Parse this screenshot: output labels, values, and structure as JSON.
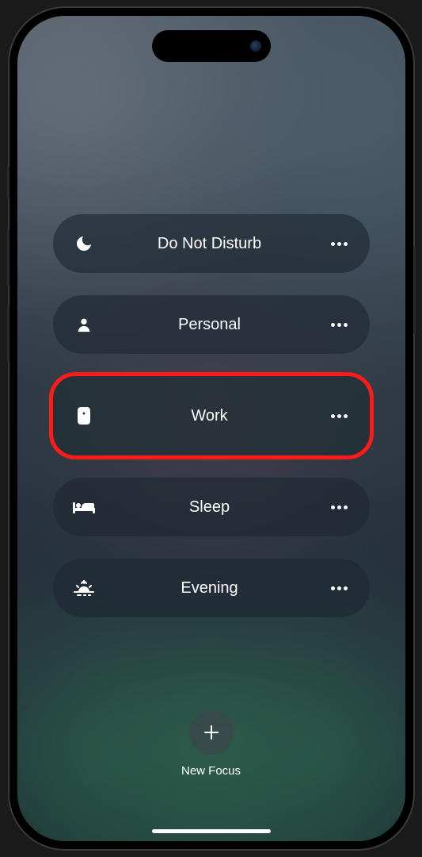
{
  "focus_modes": [
    {
      "id": "do-not-disturb",
      "label": "Do Not Disturb",
      "icon": "moon-icon",
      "highlighted": false
    },
    {
      "id": "personal",
      "label": "Personal",
      "icon": "person-icon",
      "highlighted": false
    },
    {
      "id": "work",
      "label": "Work",
      "icon": "badge-icon",
      "highlighted": true
    },
    {
      "id": "sleep",
      "label": "Sleep",
      "icon": "bed-icon",
      "highlighted": false
    },
    {
      "id": "evening",
      "label": "Evening",
      "icon": "sunset-icon",
      "highlighted": false
    }
  ],
  "new_focus": {
    "label": "New Focus"
  }
}
